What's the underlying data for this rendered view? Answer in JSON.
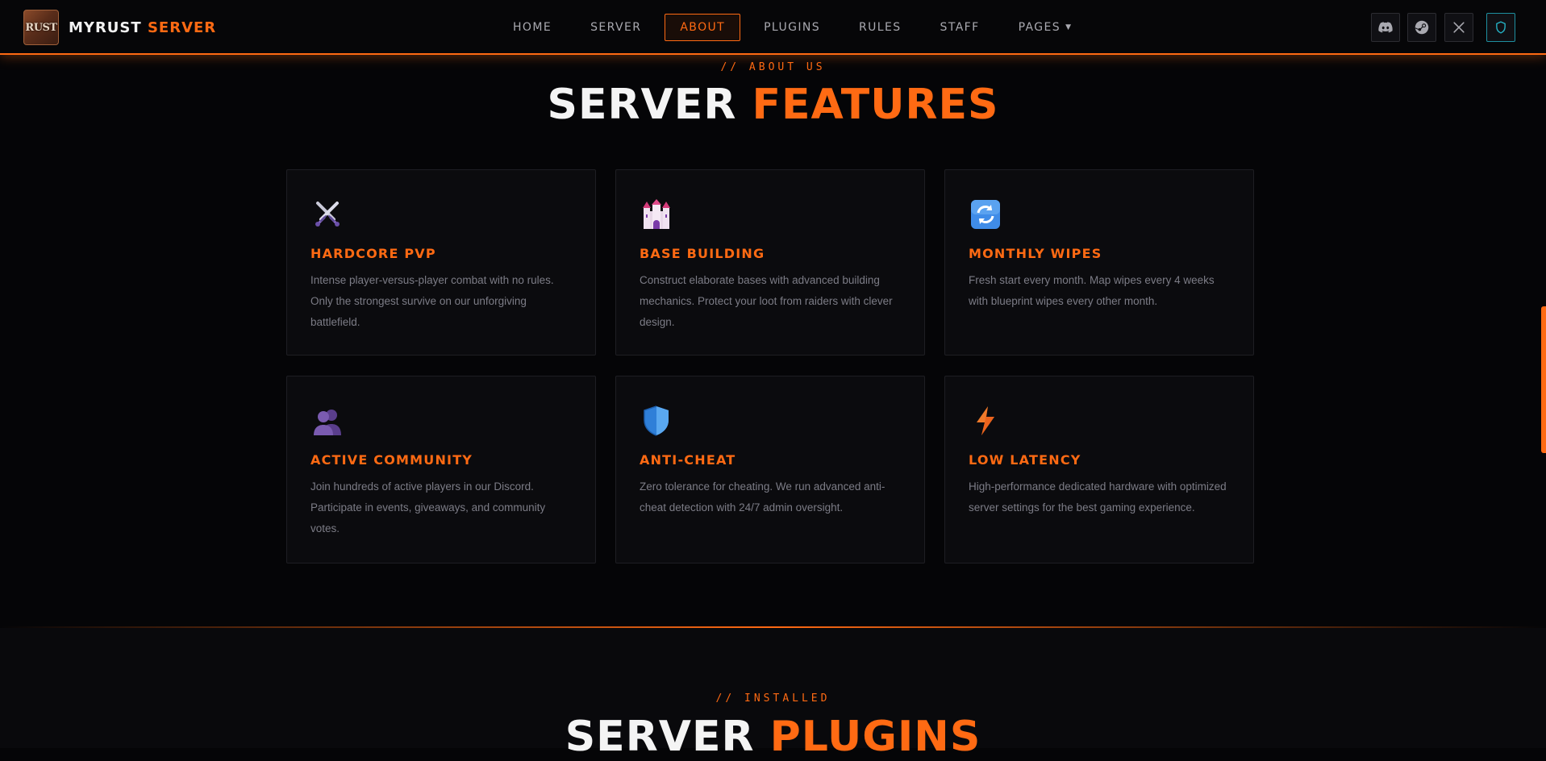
{
  "brand": {
    "logo_text": "RUST",
    "name_white": "MYRUST",
    "name_orange": "SERVER"
  },
  "nav": {
    "items": [
      {
        "label": "HOME",
        "active": false
      },
      {
        "label": "SERVER",
        "active": false
      },
      {
        "label": "ABOUT",
        "active": true
      },
      {
        "label": "PLUGINS",
        "active": false
      },
      {
        "label": "RULES",
        "active": false
      },
      {
        "label": "STAFF",
        "active": false
      },
      {
        "label": "PAGES",
        "active": false,
        "dropdown": true
      }
    ],
    "caret": "▼",
    "social": [
      "discord-icon",
      "steam-icon",
      "x-icon",
      "shield-icon"
    ]
  },
  "features": {
    "eyebrow": "// ABOUT US",
    "title_white": "SERVER",
    "title_orange": "FEATURES",
    "cards": [
      {
        "icon": "crossed-swords-icon",
        "title": "HARDCORE PVP",
        "text": "Intense player-versus-player combat with no rules. Only the strongest survive on our unforgiving battlefield."
      },
      {
        "icon": "castle-icon",
        "title": "BASE BUILDING",
        "text": "Construct elaborate bases with advanced building mechanics. Protect your loot from raiders with clever design."
      },
      {
        "icon": "refresh-icon",
        "title": "MONTHLY WIPES",
        "text": "Fresh start every month. Map wipes every 4 weeks with blueprint wipes every other month."
      },
      {
        "icon": "users-icon",
        "title": "ACTIVE COMMUNITY",
        "text": "Join hundreds of active players in our Discord. Participate in events, giveaways, and community votes."
      },
      {
        "icon": "shield-icon",
        "title": "ANTI-CHEAT",
        "text": "Zero tolerance for cheating. We run advanced anti-cheat detection with 24/7 admin oversight."
      },
      {
        "icon": "lightning-icon",
        "title": "LOW LATENCY",
        "text": "High-performance dedicated hardware with optimized server settings for the best gaming experience."
      }
    ]
  },
  "plugins": {
    "eyebrow": "// INSTALLED",
    "title_white": "SERVER",
    "title_orange": "PLUGINS"
  },
  "colors": {
    "accent": "#ff6a13",
    "background": "#050507",
    "card": "#0b0b0e",
    "muted_text": "#7c7c86"
  }
}
